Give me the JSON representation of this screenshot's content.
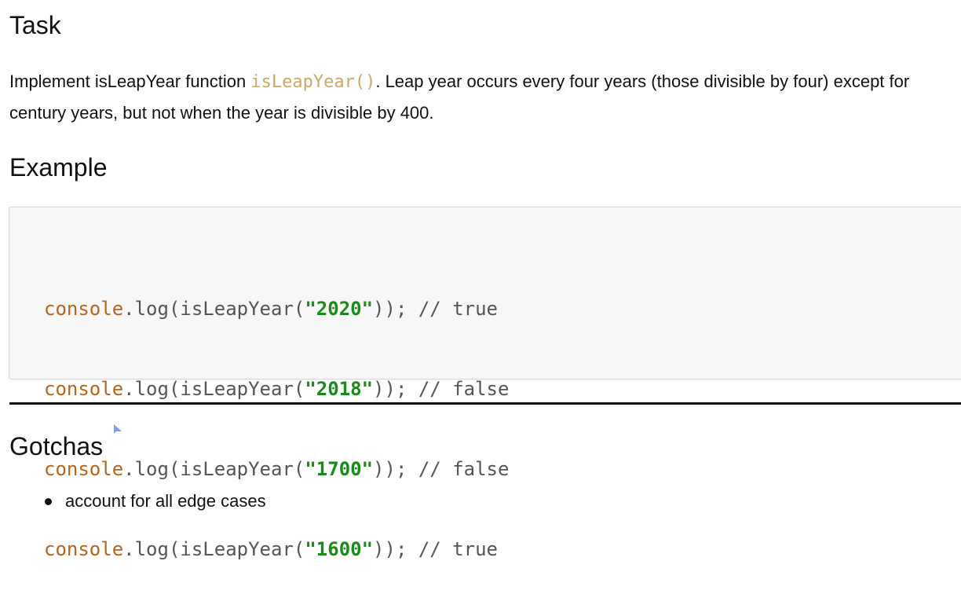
{
  "task": {
    "heading": "Task",
    "text_before": "Implement isLeapYear function ",
    "inline_code": "isLeapYear()",
    "text_after": ". Leap year occurs every four years (those divisible by four) except for century years, but not when the year is divisible by 400."
  },
  "example": {
    "heading": "Example",
    "lines": [
      {
        "object": "console",
        "method": ".log(isLeapYear(",
        "arg": "\"2020\"",
        "close": ")); ",
        "comment": "// true"
      },
      {
        "object": "console",
        "method": ".log(isLeapYear(",
        "arg": "\"2018\"",
        "close": ")); ",
        "comment": "// false"
      },
      {
        "object": "console",
        "method": ".log(isLeapYear(",
        "arg": "\"1700\"",
        "close": ")); ",
        "comment": "// false"
      },
      {
        "object": "console",
        "method": ".log(isLeapYear(",
        "arg": "\"1600\"",
        "close": ")); ",
        "comment": "// true"
      }
    ]
  },
  "gotchas": {
    "heading": "Gotchas",
    "items": [
      "account for all edge cases"
    ]
  },
  "colors": {
    "inline_code": "#c9a96a",
    "code_object": "#b5651d",
    "code_string": "#1a8a1a",
    "code_background": "#f7f7f7",
    "cursor": "#7b9ef0"
  }
}
